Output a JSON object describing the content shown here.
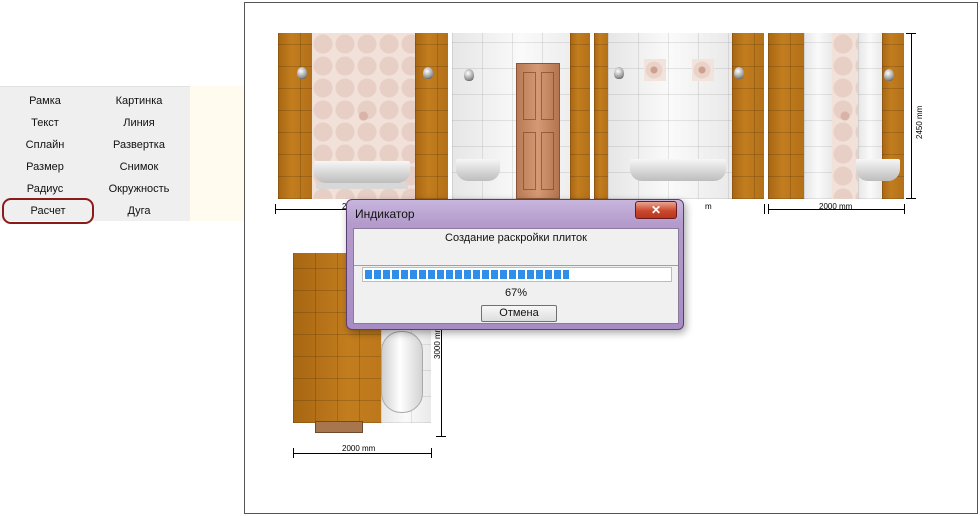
{
  "tools": {
    "col1": [
      "Рамка",
      "Текст",
      "Сплайн",
      "Размер",
      "Радиус",
      "Расчет"
    ],
    "col2": [
      "Картинка",
      "Линия",
      "Развертка",
      "Снимок",
      "Окружность",
      "Дуга"
    ]
  },
  "drawing": {
    "dims": {
      "wall_width": "2000 mm",
      "wall_height": "2450 mm",
      "floor_width": "2000 mm",
      "floor_height": "3000 mm",
      "partial_left": "2",
      "partial_right": "m"
    }
  },
  "dialog": {
    "title": "Индикатор",
    "close_label": "✕",
    "message": "Создание раскройки плиток",
    "progress": 67,
    "progress_label": "67%",
    "cancel_label": "Отмена"
  }
}
